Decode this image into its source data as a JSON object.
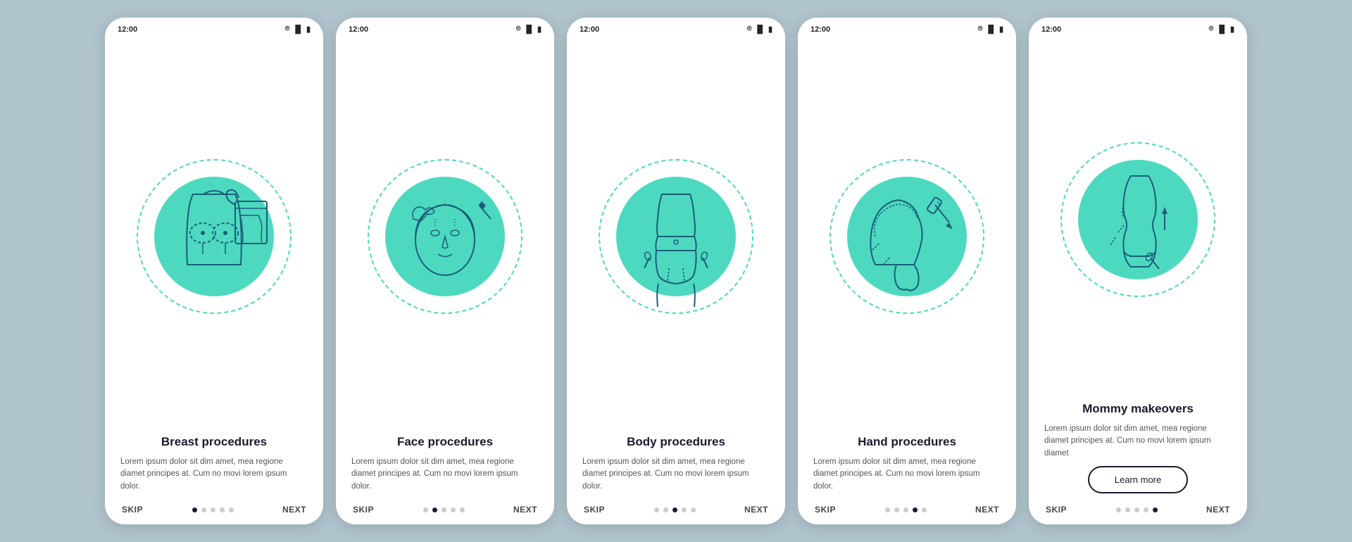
{
  "screens": [
    {
      "id": "breast",
      "status_time": "12:00",
      "title": "Breast\nprocedures",
      "description": "Lorem ipsum dolor sit dim amet, mea regione diamet principes at. Cum no movi lorem ipsum dolor.",
      "active_dot": 0,
      "has_learn_more": false,
      "skip_label": "SKIP",
      "next_label": "NEXT"
    },
    {
      "id": "face",
      "status_time": "12:00",
      "title": "Face\nprocedures",
      "description": "Lorem ipsum dolor sit dim amet, mea regione diamet principes at. Cum no movi lorem ipsum dolor.",
      "active_dot": 1,
      "has_learn_more": false,
      "skip_label": "SKIP",
      "next_label": "NEXT"
    },
    {
      "id": "body",
      "status_time": "12:00",
      "title": "Body\nprocedures",
      "description": "Lorem ipsum dolor sit dim amet, mea regione diamet principes at. Cum no movi lorem ipsum dolor.",
      "active_dot": 2,
      "has_learn_more": false,
      "skip_label": "SKIP",
      "next_label": "NEXT"
    },
    {
      "id": "hand",
      "status_time": "12:00",
      "title": "Hand\nprocedures",
      "description": "Lorem ipsum dolor sit dim amet, mea regione diamet principes at. Cum no movi lorem ipsum dolor.",
      "active_dot": 3,
      "has_learn_more": false,
      "skip_label": "SKIP",
      "next_label": "NEXT"
    },
    {
      "id": "mommy",
      "status_time": "12:00",
      "title": "Mommy\nmakeovers",
      "description": "Lorem ipsum dolor sit dim amet, mea regione diamet principes at. Cum no movi lorem ipsum diamet",
      "active_dot": 4,
      "has_learn_more": true,
      "learn_more_label": "Learn more",
      "skip_label": "SKIP",
      "next_label": "NEXT"
    }
  ],
  "dots_count": 5,
  "colors": {
    "teal": "#4dd9c0",
    "dark": "#1a1a2e",
    "text": "#555555",
    "dot_inactive": "#cccccc"
  }
}
